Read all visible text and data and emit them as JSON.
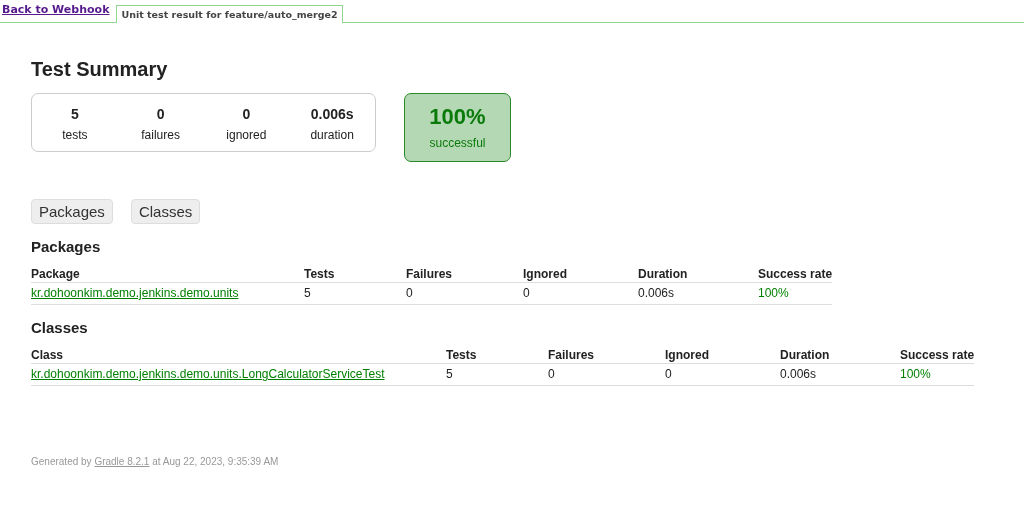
{
  "top_bar": {
    "back_link": "Back to Webhook",
    "tabs": [
      {
        "label": "Unit test result for feature/auto_merge2",
        "selected": true
      }
    ]
  },
  "title": "Test Summary",
  "counters": [
    {
      "value": "5",
      "label": "tests"
    },
    {
      "value": "0",
      "label": "failures"
    },
    {
      "value": "0",
      "label": "ignored"
    },
    {
      "value": "0.006s",
      "label": "duration"
    }
  ],
  "success_rate": {
    "value": "100%",
    "label": "successful",
    "passed": true
  },
  "view_buttons": [
    "Packages",
    "Classes"
  ],
  "sections": [
    {
      "title": "Packages",
      "columns": [
        "Package",
        "Tests",
        "Failures",
        "Ignored",
        "Duration",
        "Success rate"
      ],
      "rows": [
        {
          "name": "kr.dohoonkim.demo.jenkins.demo.units",
          "tests": "5",
          "failures": "0",
          "ignored": "0",
          "duration": "0.006s",
          "success_rate": "100%",
          "passed": true
        }
      ]
    },
    {
      "title": "Classes",
      "columns": [
        "Class",
        "Tests",
        "Failures",
        "Ignored",
        "Duration",
        "Success rate"
      ],
      "rows": [
        {
          "name": "kr.dohoonkim.demo.jenkins.demo.units.LongCalculatorServiceTest",
          "tests": "5",
          "failures": "0",
          "ignored": "0",
          "duration": "0.006s",
          "success_rate": "100%",
          "passed": true
        }
      ]
    }
  ],
  "footer": {
    "prefix": "Generated by",
    "link": "Gradle 8.2.1",
    "suffix": "at Aug 22, 2023, 9:35:39 AM"
  }
}
